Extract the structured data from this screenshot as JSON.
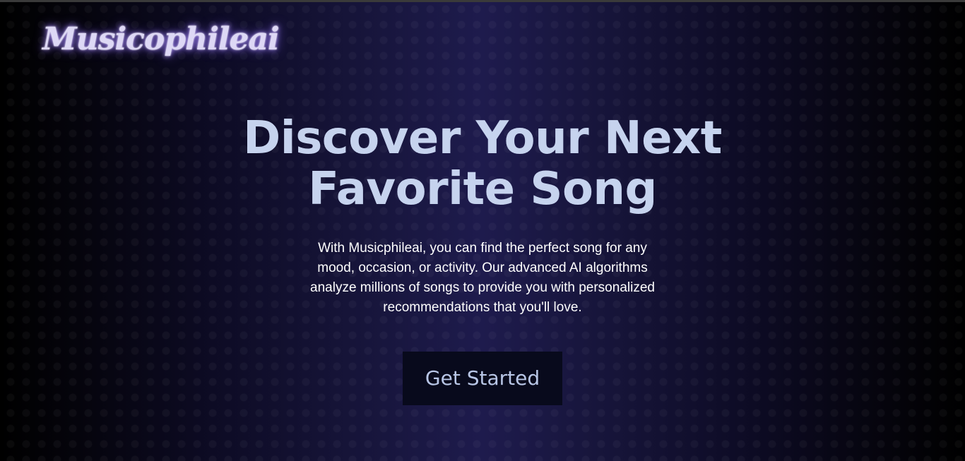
{
  "brand": {
    "logo_text": "Musicophileai"
  },
  "hero": {
    "headline_line1": "Discover Your Next",
    "headline_line2": "Favorite Song",
    "description": "With Musicphileai, you can find the perfect song for any mood, occasion, or activity. Our advanced AI algorithms analyze millions of songs to provide you with personalized recommendations that you'll love.",
    "cta_label": "Get Started"
  },
  "colors": {
    "background_center": "#1e1b4d",
    "background_edge": "#000000",
    "headline": "#c6d3ee",
    "button_bg": "#080a1c",
    "button_text": "#b8c6e6",
    "logo_glow": "#8c6eff"
  }
}
